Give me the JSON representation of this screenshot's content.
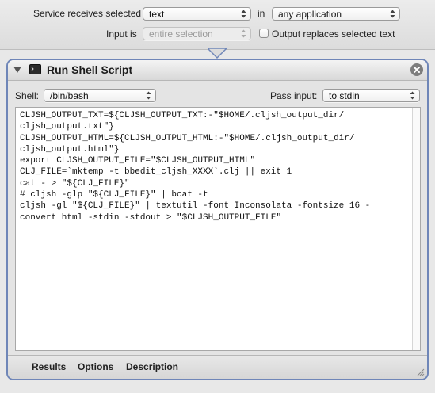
{
  "header": {
    "service_receives_label": "Service receives selected",
    "service_type": "text",
    "in_label": "in",
    "application": "any application",
    "input_is_label": "Input is",
    "input_is_value": "entire selection",
    "output_replaces_label": "Output replaces selected text",
    "output_replaces_checked": false
  },
  "action": {
    "title": "Run Shell Script",
    "shell_label": "Shell:",
    "shell_value": "/bin/bash",
    "pass_input_label": "Pass input:",
    "pass_input_value": "to stdin",
    "script": "CLJSH_OUTPUT_TXT=${CLJSH_OUTPUT_TXT:-\"$HOME/.cljsh_output_dir/\ncljsh_output.txt\"}\nCLJSH_OUTPUT_HTML=${CLJSH_OUTPUT_HTML:-\"$HOME/.cljsh_output_dir/\ncljsh_output.html\"}\nexport CLJSH_OUTPUT_FILE=\"$CLJSH_OUTPUT_HTML\"\nCLJ_FILE=`mktemp -t bbedit_cljsh_XXXX`.clj || exit 1\ncat - > \"${CLJ_FILE}\"\n# cljsh -glp \"${CLJ_FILE}\" | bcat -t\ncljsh -gl \"${CLJ_FILE}\" | textutil -font Inconsolata -fontsize 16 -\nconvert html -stdin -stdout > \"$CLJSH_OUTPUT_FILE\""
  },
  "bottom": {
    "results_label": "Results",
    "options_label": "Options",
    "description_label": "Description"
  },
  "colors": {
    "panel_border": "#6f86b8",
    "background": "#e8e8e8"
  }
}
